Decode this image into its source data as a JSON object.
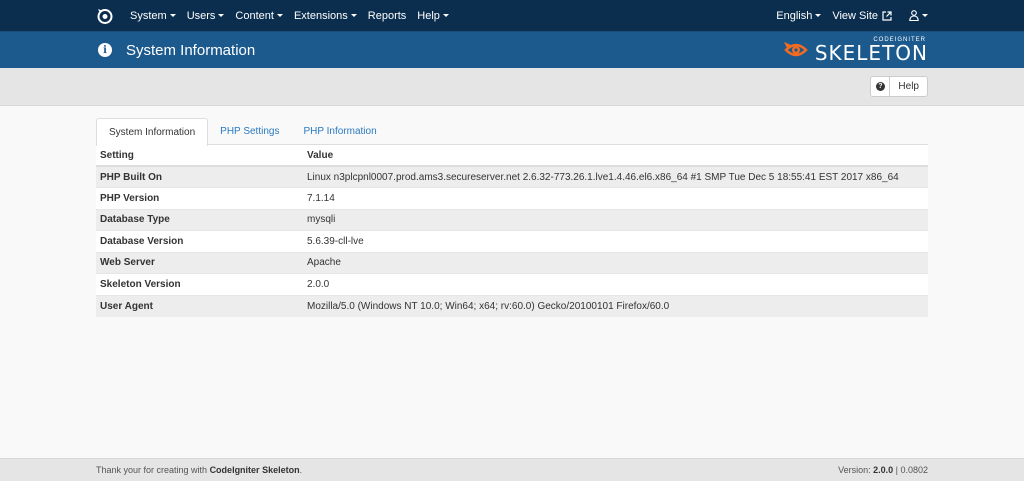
{
  "nav": {
    "menu": [
      {
        "label": "System",
        "dropdown": true
      },
      {
        "label": "Users",
        "dropdown": true
      },
      {
        "label": "Content",
        "dropdown": true
      },
      {
        "label": "Extensions",
        "dropdown": true
      },
      {
        "label": "Reports",
        "dropdown": false
      },
      {
        "label": "Help",
        "dropdown": true
      }
    ],
    "language": "English",
    "view_site": "View Site"
  },
  "header": {
    "title": "System Information",
    "logo_small": "CODEIGNITER",
    "logo_big": "SKELETON"
  },
  "toolbar": {
    "help_label": "Help"
  },
  "tabs": [
    {
      "label": "System Information",
      "active": true
    },
    {
      "label": "PHP Settings",
      "active": false
    },
    {
      "label": "PHP Information",
      "active": false
    }
  ],
  "table": {
    "headers": [
      "Setting",
      "Value"
    ],
    "rows": [
      {
        "key": "PHP Built On",
        "value": "Linux n3plcpnl0007.prod.ams3.secureserver.net 2.6.32-773.26.1.lve1.4.46.el6.x86_64 #1 SMP Tue Dec 5 18:55:41 EST 2017 x86_64"
      },
      {
        "key": "PHP Version",
        "value": "7.1.14"
      },
      {
        "key": "Database Type",
        "value": "mysqli"
      },
      {
        "key": "Database Version",
        "value": "5.6.39-cll-lve"
      },
      {
        "key": "Web Server",
        "value": "Apache"
      },
      {
        "key": "Skeleton Version",
        "value": "2.0.0"
      },
      {
        "key": "User Agent",
        "value": "Mozilla/5.0 (Windows NT 10.0; Win64; x64; rv:60.0) Gecko/20100101 Firefox/60.0"
      }
    ]
  },
  "footer": {
    "thanks_prefix": "Thank your for creating with ",
    "thanks_link": "CodeIgniter Skeleton",
    "thanks_suffix": ".",
    "version_prefix": "Version: ",
    "version": "2.0.0",
    "version_sep": " | ",
    "elapsed": "0.0802"
  },
  "colors": {
    "navbar": "#0b2e4f",
    "header": "#1c5a8e",
    "accent": "#f26b21",
    "link": "#2a7ac0"
  }
}
